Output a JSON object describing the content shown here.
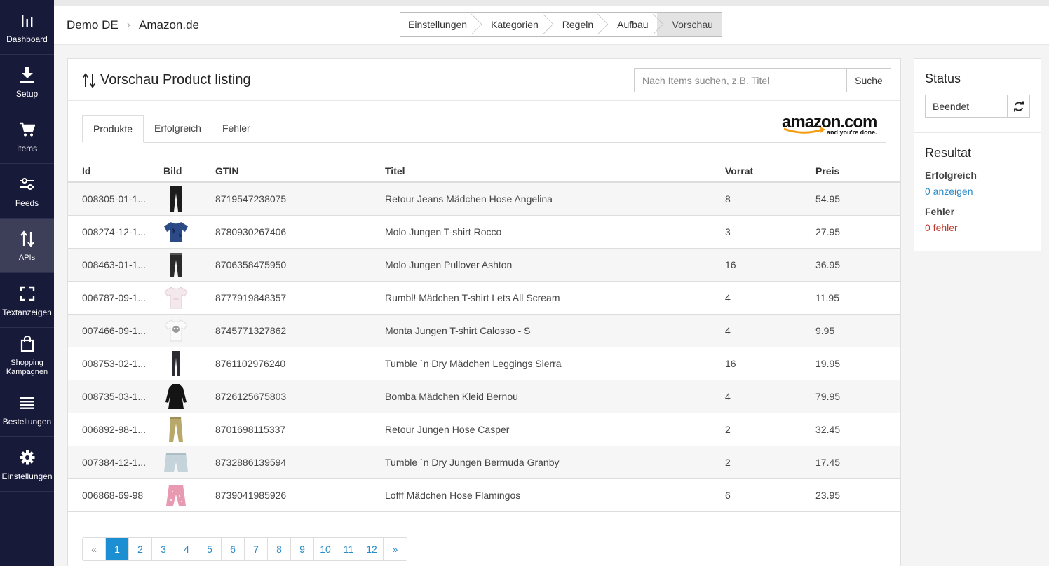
{
  "sidebar": {
    "items": [
      {
        "label": "Dashboard",
        "icon": "bar-chart-icon"
      },
      {
        "label": "Setup",
        "icon": "download-icon"
      },
      {
        "label": "Items",
        "icon": "cart-icon"
      },
      {
        "label": "Feeds",
        "icon": "sliders-icon"
      },
      {
        "label": "APIs",
        "icon": "sort-arrows-icon",
        "active": true
      },
      {
        "label": "Textanzeigen",
        "icon": "expand-icon"
      },
      {
        "label": "Shopping Kampagnen",
        "icon": "bag-icon"
      },
      {
        "label": "Bestellungen",
        "icon": "list-icon"
      },
      {
        "label": "Einstellungen",
        "icon": "gear-icon"
      }
    ]
  },
  "breadcrumb": {
    "shop": "Demo DE",
    "channel": "Amazon.de"
  },
  "steps": [
    "Einstellungen",
    "Kategorien",
    "Regeln",
    "Aufbau",
    "Vorschau"
  ],
  "panel": {
    "title": "Vorschau Product listing",
    "search_placeholder": "Nach Items suchen, z.B. Titel",
    "search_button": "Suche",
    "tabs": [
      "Produkte",
      "Erfolgreich",
      "Fehler"
    ],
    "logo_text": "amazon.com",
    "logo_tagline": "and you're done."
  },
  "table": {
    "headers": [
      "Id",
      "Bild",
      "GTIN",
      "Titel",
      "Vorrat",
      "Preis"
    ],
    "rows": [
      {
        "id": "008305-01-1...",
        "gtin": "8719547238075",
        "title": "Retour Jeans Mädchen Hose Angelina",
        "stock": "8",
        "price": "54.95",
        "img": "jeans"
      },
      {
        "id": "008274-12-1...",
        "gtin": "8780930267406",
        "title": "Molo Jungen T-shirt Rocco",
        "stock": "3",
        "price": "27.95",
        "img": "tshirt-blue"
      },
      {
        "id": "008463-01-1...",
        "gtin": "8706358475950",
        "title": "Molo Jungen Pullover Ashton",
        "stock": "16",
        "price": "36.95",
        "img": "pants-dark"
      },
      {
        "id": "006787-09-1...",
        "gtin": "8777919848357",
        "title": "Rumbl! Mädchen T-shirt Lets All Scream",
        "stock": "4",
        "price": "11.95",
        "img": "tshirt-white"
      },
      {
        "id": "007466-09-1...",
        "gtin": "8745771327862",
        "title": "Monta Jungen T-shirt Calosso - S",
        "stock": "4",
        "price": "9.95",
        "img": "tshirt-skull"
      },
      {
        "id": "008753-02-1...",
        "gtin": "8761102976240",
        "title": "Tumble `n Dry Mädchen Leggings Sierra",
        "stock": "16",
        "price": "19.95",
        "img": "leggings"
      },
      {
        "id": "008735-03-1...",
        "gtin": "8726125675803",
        "title": "Bomba Mädchen Kleid Bernou",
        "stock": "4",
        "price": "79.95",
        "img": "dress"
      },
      {
        "id": "006892-98-1...",
        "gtin": "8701698115337",
        "title": "Retour Jungen Hose Casper",
        "stock": "2",
        "price": "32.45",
        "img": "pants-khaki"
      },
      {
        "id": "007384-12-1...",
        "gtin": "8732886139594",
        "title": "Tumble `n Dry Jungen Bermuda Granby",
        "stock": "2",
        "price": "17.45",
        "img": "shorts"
      },
      {
        "id": "006868-69-98",
        "gtin": "8739041985926",
        "title": "Lofff Mädchen Hose Flamingos",
        "stock": "6",
        "price": "23.95",
        "img": "pants-pink"
      }
    ]
  },
  "pagination": {
    "prev": "«",
    "next": "»",
    "pages": [
      "1",
      "2",
      "3",
      "4",
      "5",
      "6",
      "7",
      "8",
      "9",
      "10",
      "11",
      "12"
    ],
    "current": "1"
  },
  "status": {
    "heading": "Status",
    "value": "Beendet",
    "result_heading": "Resultat",
    "success_label": "Erfolgreich",
    "success_link": "0 anzeigen",
    "error_label": "Fehler",
    "error_link": "0 fehler"
  }
}
